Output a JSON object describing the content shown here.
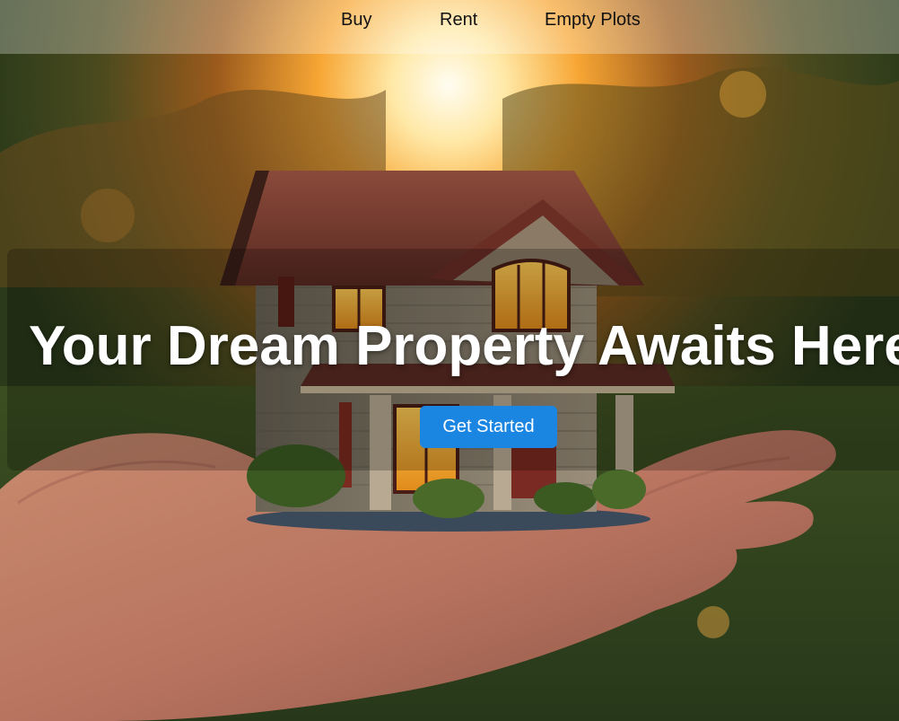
{
  "nav": {
    "items": [
      {
        "label": "Buy"
      },
      {
        "label": "Rent"
      },
      {
        "label": "Empty Plots"
      }
    ]
  },
  "hero": {
    "title": "Your Dream Property Awaits Here.",
    "cta_label": "Get Started"
  },
  "colors": {
    "cta_background": "#1a86e2",
    "title_text": "#ffffff",
    "nav_text": "#111111"
  },
  "image": {
    "description_icon": "house-in-hand-image"
  }
}
